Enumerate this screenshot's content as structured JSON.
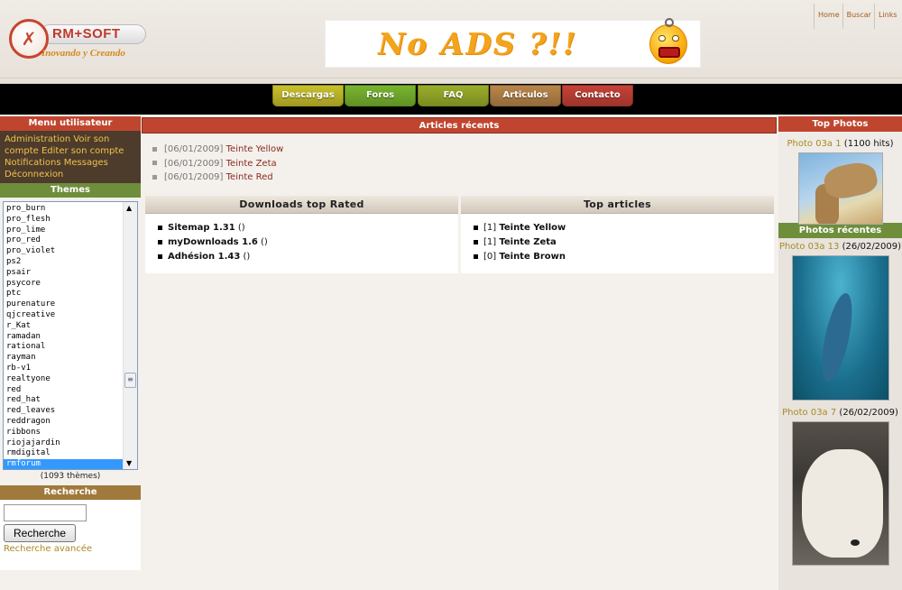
{
  "colors": {
    "nav_black": "#000000",
    "accent_red": "#c0452f",
    "accent_brown": "#a07a3c",
    "accent_green": "#6f8e3c",
    "link_red": "#8b2a1f",
    "link_gold": "#a88a22"
  },
  "header": {
    "logo_name": "RM+SOFT",
    "logo_tagline": "Inovando y Creando",
    "banner_text": "No ADS ?!!",
    "links": [
      "Home",
      "Buscar",
      "Links"
    ]
  },
  "nav": {
    "items": [
      {
        "label": "Descargas",
        "color": "#c9c12b"
      },
      {
        "label": "Foros",
        "color": "#79b52e"
      },
      {
        "label": "FAQ",
        "color": "#9aae2a"
      },
      {
        "label": "Articulos",
        "color": "#b8864a"
      },
      {
        "label": "Contacto",
        "color": "#c64237"
      }
    ]
  },
  "left": {
    "menu_title": "Menu utilisateur",
    "menu_links": [
      "Administration",
      "Voir son compte",
      "Editer son compte",
      "Notifications",
      "Messages",
      "Déconnexion"
    ],
    "themes_title": "Themes",
    "themes": [
      "pro_burn",
      "pro_flesh",
      "pro_lime",
      "pro_red",
      "pro_violet",
      "ps2",
      "psair",
      "psycore",
      "ptc",
      "purenature",
      "qjcreative",
      "r_Kat",
      "ramadan",
      "rational",
      "rayman",
      "rb-v1",
      "realtyone",
      "red",
      "red_hat",
      "red_leaves",
      "reddragon",
      "ribbons",
      "riojajardin",
      "rmdigital",
      "rmforum"
    ],
    "selected_theme": "rmforum",
    "theme_count": "(1093 thèmes)",
    "search_title": "Recherche",
    "search_value": "",
    "search_button": "Recherche",
    "advanced_search": "Recherche avancée"
  },
  "center": {
    "recent_title": "Articles récents",
    "recent_articles": [
      {
        "date": "[06/01/2009]",
        "title": "Teinte Yellow"
      },
      {
        "date": "[06/01/2009]",
        "title": "Teinte Zeta"
      },
      {
        "date": "[06/01/2009]",
        "title": "Teinte Red"
      }
    ],
    "downloads_title": "Downloads top Rated",
    "downloads": [
      {
        "name": "Sitemap 1.31",
        "extra": "()"
      },
      {
        "name": "myDownloads 1.6",
        "extra": "()"
      },
      {
        "name": "Adhésion 1.43",
        "extra": "()"
      }
    ],
    "top_articles_title": "Top articles",
    "top_articles": [
      {
        "count": "[1]",
        "name": "Teinte Yellow"
      },
      {
        "count": "[1]",
        "name": "Teinte Zeta"
      },
      {
        "count": "[0]",
        "name": "Teinte Brown"
      }
    ]
  },
  "right": {
    "top_photos_title": "Top Photos",
    "top_photo": {
      "name": "Photo 03a 1",
      "meta": "(1100 hits)"
    },
    "recent_photos_title": "Photos récentes",
    "recent_photos": [
      {
        "name": "Photo 03a 13",
        "meta": "(26/02/2009)"
      },
      {
        "name": "Photo 03a 7",
        "meta": "(26/02/2009)"
      }
    ]
  }
}
